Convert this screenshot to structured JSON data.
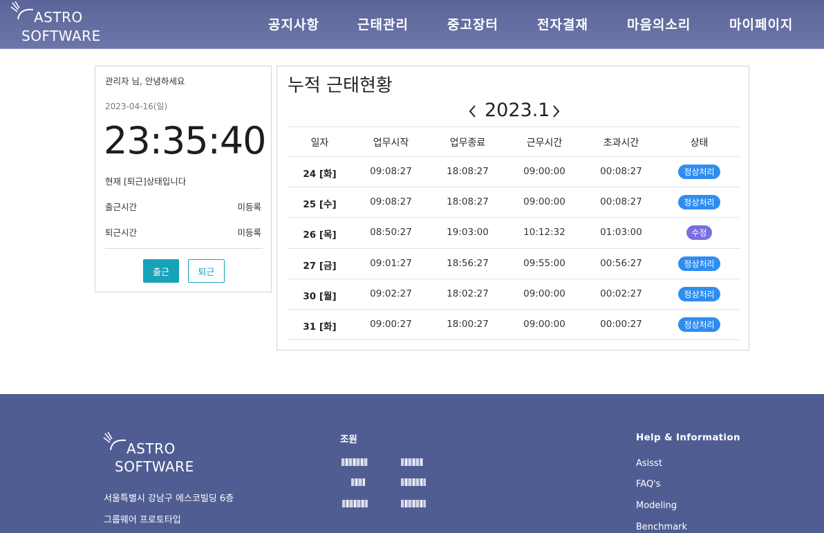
{
  "header": {
    "logo_line1": "ASTRO",
    "logo_line2": "SOFTWARE",
    "nav": [
      "공지사항",
      "근태관리",
      "중고장터",
      "전자결재",
      "마음의소리",
      "마이페이지"
    ]
  },
  "user_panel": {
    "greeting": "관리자 님, 안녕하세요",
    "date": "2023-04-16(일)",
    "clock": "23:35:40",
    "status": "현재 [퇴근]상태입니다",
    "check_in_label": "출근시간",
    "check_in_value": "미등록",
    "check_out_label": "퇴근시간",
    "check_out_value": "미등록",
    "btn_check_in": "출근",
    "btn_check_out": "퇴근"
  },
  "attendance": {
    "title": "누적 근태현황",
    "month": "2023.1",
    "columns": [
      "일자",
      "업무시작",
      "업무종료",
      "근무시간",
      "초과시간",
      "상태"
    ],
    "rows": [
      {
        "day": "24 [화]",
        "start": "09:08:27",
        "end": "18:08:27",
        "work": "09:00:00",
        "over": "00:08:27",
        "status": "정상처리",
        "status_type": "ok"
      },
      {
        "day": "25 [수]",
        "start": "09:08:27",
        "end": "18:08:27",
        "work": "09:00:00",
        "over": "00:08:27",
        "status": "정상처리",
        "status_type": "ok"
      },
      {
        "day": "26 [목]",
        "start": "08:50:27",
        "end": "19:03:00",
        "work": "10:12:32",
        "over": "01:03:00",
        "status": "수정",
        "status_type": "edit"
      },
      {
        "day": "27 [금]",
        "start": "09:01:27",
        "end": "18:56:27",
        "work": "09:55:00",
        "over": "00:56:27",
        "status": "정상처리",
        "status_type": "ok"
      },
      {
        "day": "30 [월]",
        "start": "09:02:27",
        "end": "18:02:27",
        "work": "09:00:00",
        "over": "00:02:27",
        "status": "정상처리",
        "status_type": "ok"
      },
      {
        "day": "31 [화]",
        "start": "09:00:27",
        "end": "18:00:27",
        "work": "09:00:00",
        "over": "00:00:27",
        "status": "정상처리",
        "status_type": "ok"
      }
    ]
  },
  "footer": {
    "logo_line1": "ASTRO",
    "logo_line2": "SOFTWARE",
    "address": "서울특별시 강남구 에스코빌딩 6층",
    "project": "그룹웨어 프로토타입",
    "team_title": "조원",
    "help_title": "Help & Information",
    "help_links": [
      "Asisst",
      "FAQ's",
      "Modeling",
      "Benchmark"
    ]
  },
  "colors": {
    "header": "#5c6599",
    "footer": "#505d93",
    "accent": "#17a2b8",
    "badge_ok": "#2f8df0",
    "badge_edit": "#7a6fe0"
  }
}
